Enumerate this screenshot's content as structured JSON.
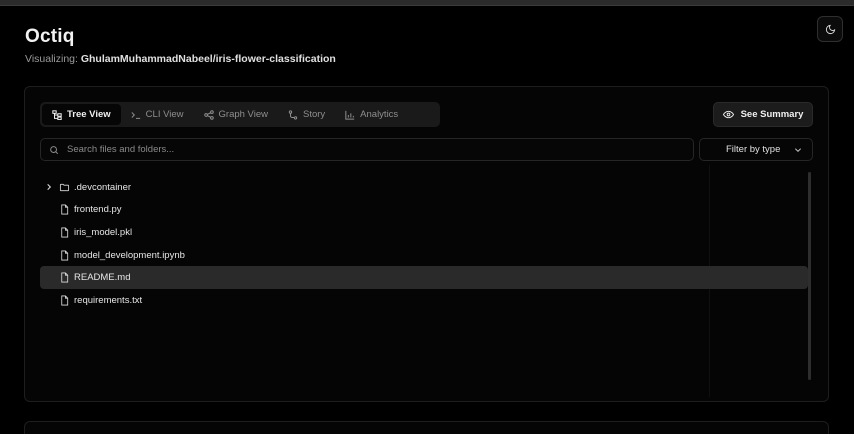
{
  "app": {
    "title": "Octiq",
    "subtitle_prefix": "Visualizing:",
    "repo": "GhulamMuhammadNabeel/iris-flower-classification"
  },
  "tabs": [
    {
      "label": "Tree View",
      "icon": "tree-icon",
      "active": true
    },
    {
      "label": "CLI View",
      "icon": "terminal-icon",
      "active": false
    },
    {
      "label": "Graph View",
      "icon": "graph-icon",
      "active": false
    },
    {
      "label": "Story",
      "icon": "story-icon",
      "active": false
    },
    {
      "label": "Analytics",
      "icon": "chart-icon",
      "active": false
    }
  ],
  "summary_button": {
    "label": "See Summary",
    "icon": "eye-icon"
  },
  "search": {
    "placeholder": "Search files and folders...",
    "value": ""
  },
  "filter": {
    "label": "Filter by type"
  },
  "files": [
    {
      "name": ".devcontainer",
      "type": "folder",
      "expandable": true,
      "selected": false
    },
    {
      "name": "frontend.py",
      "type": "file",
      "expandable": false,
      "selected": false
    },
    {
      "name": "iris_model.pkl",
      "type": "file",
      "expandable": false,
      "selected": false
    },
    {
      "name": "model_development.ipynb",
      "type": "file",
      "expandable": false,
      "selected": false
    },
    {
      "name": "README.md",
      "type": "file",
      "expandable": false,
      "selected": true
    },
    {
      "name": "requirements.txt",
      "type": "file",
      "expandable": false,
      "selected": false
    }
  ],
  "colors": {
    "background": "#000000",
    "panel": "#050505",
    "selected_row": "#2a2a2a",
    "text": "#e6e6e6",
    "muted": "#8e8e8e"
  }
}
